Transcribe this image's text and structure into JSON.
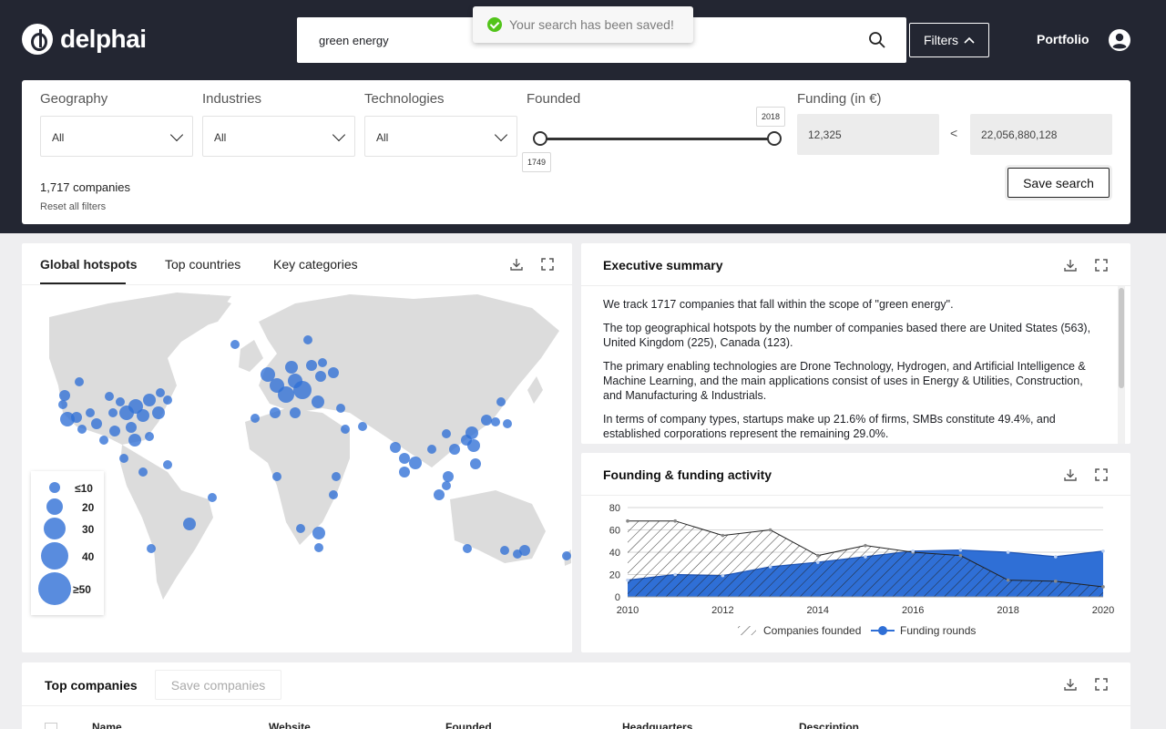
{
  "header": {
    "logo_text": "delphai",
    "search_value": "green energy",
    "toast_text": "Your search has been saved!",
    "filters_label": "Filters",
    "portfolio_label": "Portfolio"
  },
  "filters": {
    "geography_label": "Geography",
    "geography_value": "All",
    "industries_label": "Industries",
    "industries_value": "All",
    "technologies_label": "Technologies",
    "technologies_value": "All",
    "founded_label": "Founded",
    "founded_min": "1749",
    "founded_max": "2018",
    "funding_label": "Funding (in €)",
    "funding_min": "12,325",
    "funding_separator": "<",
    "funding_max": "22,056,880,128",
    "company_count": "1,717 companies",
    "reset_label": "Reset all filters",
    "save_search_label": "Save search"
  },
  "map_card": {
    "tabs": [
      "Global hotspots",
      "Top countries",
      "Key categories"
    ],
    "active_tab": 0,
    "legend": [
      "≤10",
      "20",
      "30",
      "40",
      "≥50"
    ]
  },
  "summary_card": {
    "title": "Executive summary",
    "paragraphs": [
      "We track 1717 companies that fall within the scope of \"green energy\".",
      "The top geographical hotspots by the number of companies based there are United States (563), United Kingdom (225), Canada (123).",
      "The primary enabling technologies are Drone Technology, Hydrogen, and Artificial Intelligence & Machine Learning, and the main applications consist of uses in Energy & Utilities, Construction, and Manufacturing & Industrials.",
      "In terms of company types, startups make up 21.6% of firms, SMBs constitute 49.4%, and established corporations represent the remaining 29.0%."
    ]
  },
  "activity_card": {
    "title": "Founding & funding activity",
    "legend_founded": "Companies founded",
    "legend_funding": "Funding rounds"
  },
  "chart_data": {
    "type": "area",
    "x": [
      2010,
      2011,
      2012,
      2013,
      2014,
      2015,
      2016,
      2017,
      2018,
      2019,
      2020
    ],
    "x_ticks": [
      "2010",
      "2012",
      "2014",
      "2016",
      "2018",
      "2020"
    ],
    "y_ticks": [
      "0",
      "20",
      "40",
      "60",
      "80"
    ],
    "ylim": [
      0,
      80
    ],
    "series": [
      {
        "name": "Companies founded",
        "values": [
          68,
          68,
          55,
          60,
          37,
          46,
          40,
          37,
          15,
          14,
          9
        ],
        "fill": "hatched"
      },
      {
        "name": "Funding rounds",
        "values": [
          15,
          20,
          19,
          27,
          31,
          36,
          41,
          42,
          40,
          36,
          41
        ],
        "color": "#2f6fd6"
      }
    ],
    "legend_position": "bottom",
    "grid": true
  },
  "companies_card": {
    "title": "Top companies",
    "save_label": "Save companies",
    "columns": [
      "Name",
      "Website",
      "Founded",
      "Headquarters",
      "Description"
    ]
  },
  "colors": {
    "dark_bg": "#232632",
    "accent_blue": "#2f6fd6",
    "success_green": "#52c41a"
  }
}
